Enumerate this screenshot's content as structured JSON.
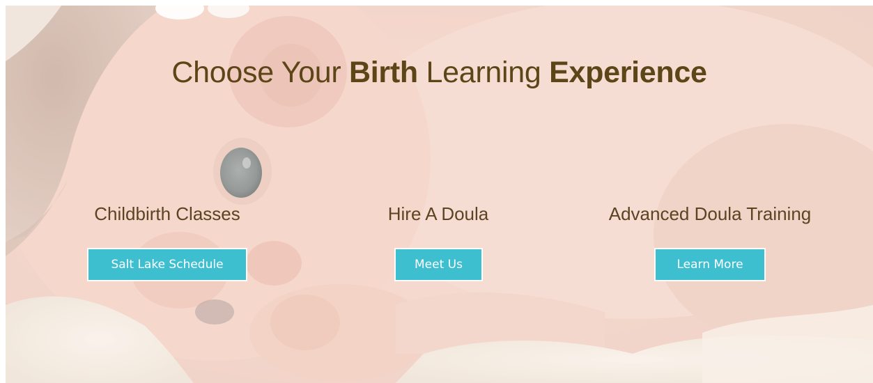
{
  "hero": {
    "title_parts": {
      "w1": "Choose Your",
      "w2": "Birth",
      "w3": "Learning",
      "w4": "Experience"
    },
    "title_color": "#5c4516",
    "accent_color": "#3ebfd0"
  },
  "columns": [
    {
      "heading": "Childbirth Classes",
      "button_label": "Salt Lake Schedule"
    },
    {
      "heading": "Hire A Doula",
      "button_label": "Meet Us"
    },
    {
      "heading": "Advanced Doula Training",
      "button_label": "Learn More"
    }
  ]
}
